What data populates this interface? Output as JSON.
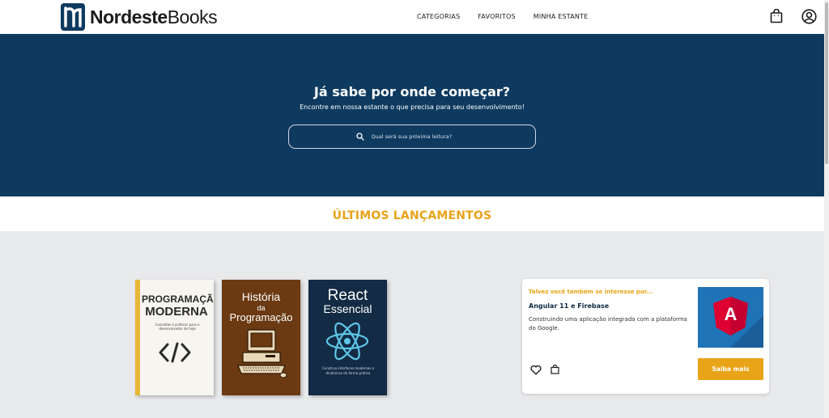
{
  "header": {
    "logo": {
      "bold": "Nordeste",
      "light": "Books"
    },
    "nav": [
      {
        "label": "CATEGORIAS"
      },
      {
        "label": "FAVORITOS"
      },
      {
        "label": "MINHA ESTANTE"
      }
    ],
    "icons": {
      "bag": "shopping-bag-icon",
      "user": "user-circle-icon"
    }
  },
  "hero": {
    "title": "Já sabe por onde começar?",
    "subtitle": "Encontre em nossa estante o que precisa para seu desenvolvimento!",
    "search_placeholder": "Qual será sua próxima leitura?"
  },
  "section": {
    "title": "ÚLTIMOS LANÇAMENTOS"
  },
  "books": [
    {
      "title_line1": "PROGRAMAÇÃO",
      "title_line2": "MODERNA",
      "subtitle": "Conceitos e práticas para o desenvolvedor de hoje"
    },
    {
      "title_line1": "História",
      "title_line2": "da",
      "title_line3": "Programação"
    },
    {
      "title_line1": "React",
      "title_line2": "Essencial",
      "subtitle": "Construa interfaces modernas e dinâmicas de forma prática"
    }
  ],
  "recommendation": {
    "kicker": "Talvez você também se interesse por...",
    "title": "Angular 11 e Firebase",
    "description": "Construindo uma aplicação integrada com a plataforma do Google.",
    "image_letter": "A",
    "cta": "Saiba mais"
  },
  "colors": {
    "navy": "#0e3a5f",
    "accent": "#e8a317",
    "gray_bg": "#e8e9eb"
  }
}
